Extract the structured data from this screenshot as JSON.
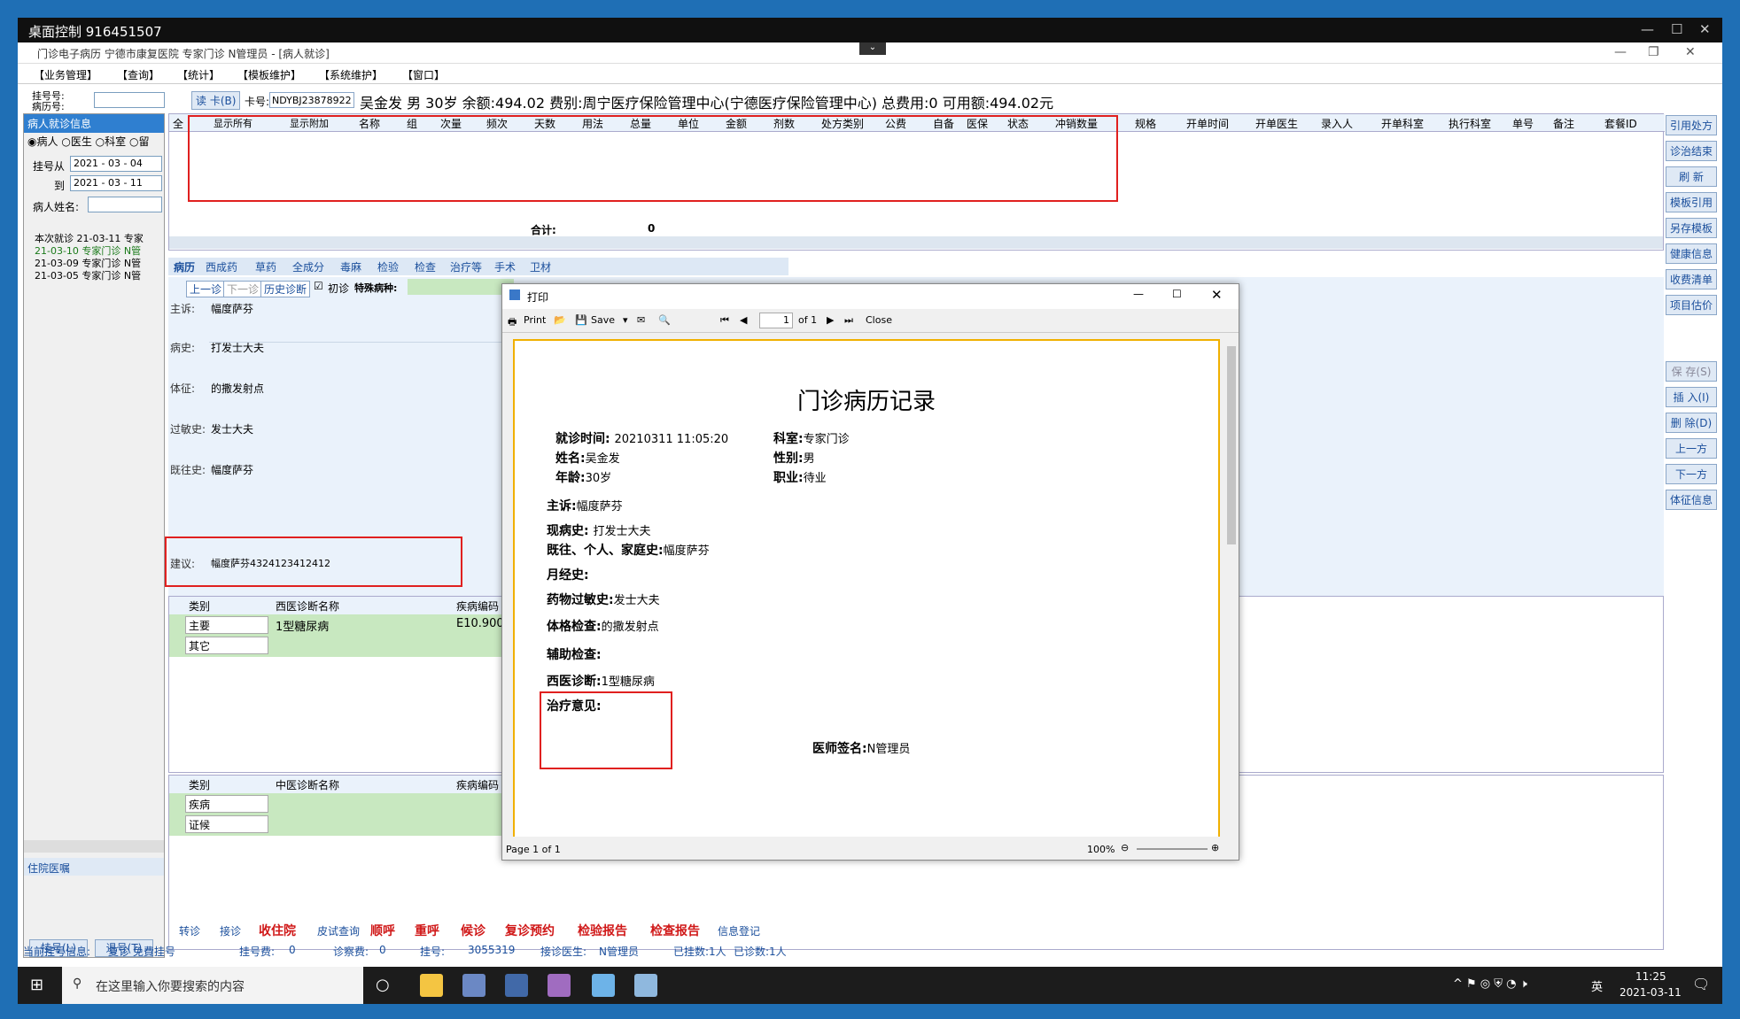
{
  "remote": {
    "title": "桌面控制 916451507"
  },
  "app": {
    "title": "门诊电子病历 宁德市康复医院 专家门诊 N管理员 - [病人就诊]"
  },
  "menu": [
    "【业务管理】",
    "【查询】",
    "【统计】",
    "【模板维护】",
    "【系统维护】",
    "【窗口】"
  ],
  "left": {
    "reg_no_label": "挂号号:",
    "record_no_label": "病历号:",
    "panel_title": "病人就诊信息",
    "radio": [
      "病人",
      "医生",
      "科室",
      "留"
    ],
    "from_label": "挂号从",
    "from_date": "2021 - 03 - 04",
    "to_label": "到",
    "to_date": "2021 - 03 - 11",
    "name_label": "病人姓名:",
    "tree": [
      "本次就诊 21-03-11 专家",
      "21-03-10 专家门诊 N管",
      "21-03-09 专家门诊 N管",
      "21-03-05 专家门诊 N管"
    ],
    "inpatient_label": "住院医嘱",
    "btn_register": "挂号(L)",
    "btn_unregister": "退号(T)"
  },
  "patient": {
    "read_card": "读 卡(B)",
    "card_label": "卡号:",
    "card_no": "NDYBJ23878922",
    "info": "吴金发  男  30岁  余额:494.02  费别:周宁医疗保险管理中心(宁德医疗保险管理中心) 总费用:0  可用额:494.02元"
  },
  "grid": {
    "headers": [
      "全",
      "显示所有",
      "显示附加",
      "名称",
      "组",
      "次量",
      "频次",
      "天数",
      "用法",
      "总量",
      "单位",
      "金额",
      "剂数",
      "处方类别",
      "公费",
      "自备",
      "医保",
      "状态",
      "冲销数量",
      "规格",
      "开单时间",
      "开单医生",
      "录入人",
      "开单科室",
      "执行科室",
      "单号",
      "备注",
      "套餐ID"
    ],
    "total_label": "合计:",
    "total_value": "0"
  },
  "right_buttons": [
    "引用处方",
    "诊治结束",
    "刷 新",
    "模板引用",
    "另存模板",
    "健康信息",
    "收费清单",
    "项目估价"
  ],
  "right_buttons2": [
    "保 存(S)",
    "插 入(I)",
    "删 除(D)",
    "上一方",
    "下一方",
    "体征信息"
  ],
  "tabs": [
    "病历",
    "西成药",
    "草药",
    "全成分",
    "毒麻",
    "检验",
    "检查",
    "治疗等",
    "手术",
    "卫材"
  ],
  "record": {
    "prev": "上一诊",
    "next": "下一诊",
    "history": "历史诊断",
    "first_visit": "初诊",
    "special": "特殊病种:",
    "fields": [
      {
        "label": "主诉:",
        "value": "幅度萨芬"
      },
      {
        "label": "病史:",
        "value": "打发士大夫"
      },
      {
        "label": "体征:",
        "value": "的撒发射点"
      },
      {
        "label": "过敏史:",
        "value": "发士大夫"
      },
      {
        "label": "既往史:",
        "value": "幅度萨芬"
      },
      {
        "label": "建议:",
        "value": "幅度萨芬4324123412412"
      }
    ]
  },
  "west_diag": {
    "headers": [
      "类别",
      "西医诊断名称",
      "疾病编码"
    ],
    "rows": [
      [
        "主要",
        "1型糖尿病",
        "E10.900"
      ],
      [
        "其它",
        "",
        ""
      ]
    ]
  },
  "cn_diag": {
    "headers": [
      "类别",
      "中医诊断名称",
      "疾病编码"
    ],
    "rows": [
      [
        "疾病",
        "",
        ""
      ],
      [
        "证候",
        "",
        ""
      ]
    ]
  },
  "bottom": {
    "buttons": [
      "转诊",
      "接诊",
      "收住院",
      "皮试查询",
      "顺呼",
      "重呼",
      "候诊",
      "复诊预约",
      "检验报告",
      "检查报告",
      "信息登记"
    ],
    "status": [
      "当前挂号信息:",
      "复诊 免費挂号",
      "挂号费:",
      "0",
      "诊察费:",
      "0",
      "挂号:",
      "3055319",
      "接诊医生:",
      "N管理员",
      "已挂数:1人",
      "已诊数:1人"
    ]
  },
  "dialog": {
    "title": "打印",
    "print": "Print",
    "save": "Save",
    "page_input": "1",
    "of": "of 1",
    "close": "Close",
    "page_status": "Page 1 of 1",
    "zoom": "100%"
  },
  "report": {
    "title": "门诊病历记录",
    "visit_time_label": "就诊时间:",
    "visit_time": "20210311 11:05:20",
    "dept_label": "科室:",
    "dept": "专家门诊",
    "name_label": "姓名:",
    "name": "吴金发",
    "sex_label": "性别:",
    "sex": "男",
    "age_label": "年龄:",
    "age": "30岁",
    "job_label": "职业:",
    "job": "待业",
    "complaint_label": "主诉:",
    "complaint": "幅度萨芬",
    "present_label": "现病史:",
    "present": "打发士大夫",
    "past_label": "既往、个人、家庭史:",
    "past": "幅度萨芬",
    "menstrual_label": "月经史:",
    "allergy_label": "药物过敏史:",
    "allergy": "发士大夫",
    "exam_label": "体格检查:",
    "exam": "的撒发射点",
    "aux_label": "辅助检查:",
    "west_label": "西医诊断:",
    "west": "1型糖尿病",
    "treat_label": "治疗意见:",
    "doctor_label": "医师签名:",
    "doctor": "N管理员"
  },
  "taskbar": {
    "search": "在这里输入你要搜索的内容",
    "time": "11:25",
    "date": "2021-03-11",
    "ime": "英"
  }
}
